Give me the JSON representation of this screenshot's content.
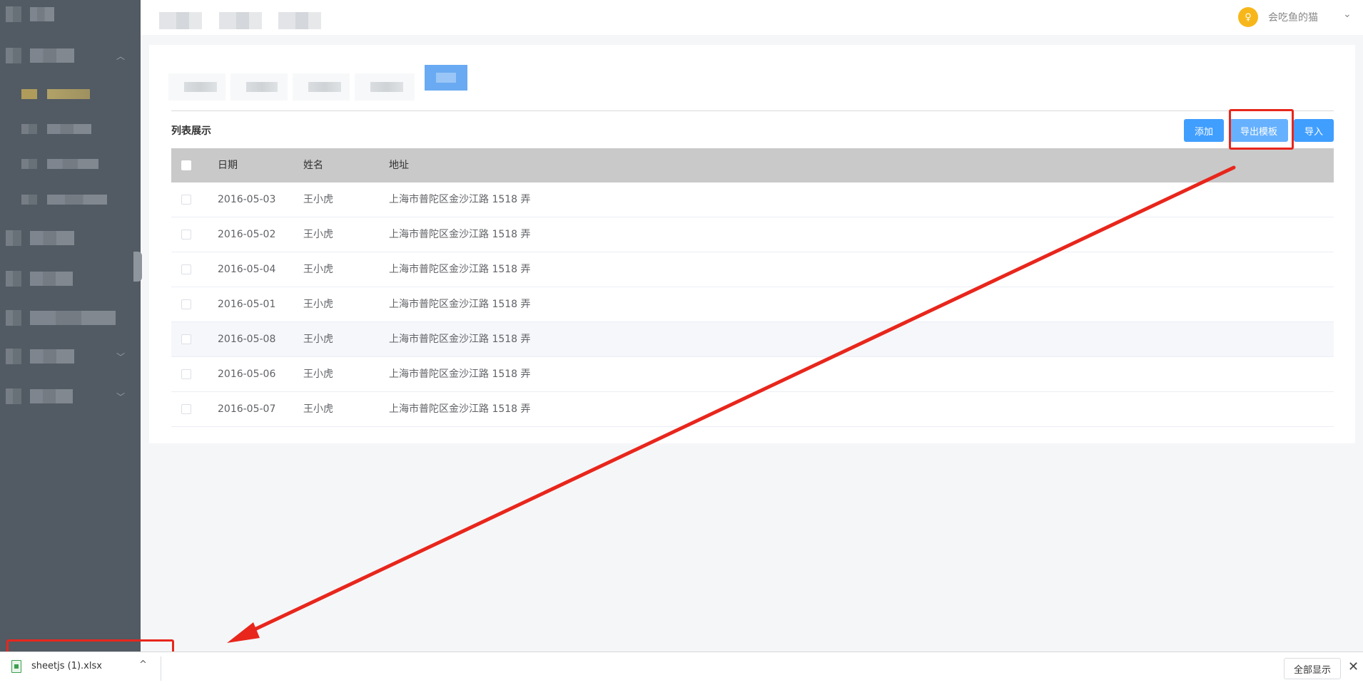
{
  "header": {
    "username": "会吃鱼的猫",
    "avatar_glyph": "♀",
    "chevron": "⌄"
  },
  "main": {
    "section_title": "列表展示",
    "buttons": {
      "add": "添加",
      "export_template": "导出模板",
      "import": "导入"
    },
    "table": {
      "columns": [
        "日期",
        "姓名",
        "地址"
      ],
      "rows": [
        {
          "date": "2016-05-03",
          "name": "王小虎",
          "address": "上海市普陀区金沙江路 1518 弄"
        },
        {
          "date": "2016-05-02",
          "name": "王小虎",
          "address": "上海市普陀区金沙江路 1518 弄"
        },
        {
          "date": "2016-05-04",
          "name": "王小虎",
          "address": "上海市普陀区金沙江路 1518 弄"
        },
        {
          "date": "2016-05-01",
          "name": "王小虎",
          "address": "上海市普陀区金沙江路 1518 弄"
        },
        {
          "date": "2016-05-08",
          "name": "王小虎",
          "address": "上海市普陀区金沙江路 1518 弄"
        },
        {
          "date": "2016-05-06",
          "name": "王小虎",
          "address": "上海市普陀区金沙江路 1518 弄"
        },
        {
          "date": "2016-05-07",
          "name": "王小虎",
          "address": "上海市普陀区金沙江路 1518 弄"
        }
      ]
    }
  },
  "download_bar": {
    "file_name": "sheetjs (1).xlsx",
    "chevron": "^",
    "show_all": "全部显示",
    "close": "✕"
  },
  "colors": {
    "primary": "#409eff",
    "primary_light": "#66b1ff",
    "annotation_red": "#e8261c",
    "sidebar_bg": "#525a63",
    "avatar": "#f7b71a"
  },
  "icons": {
    "avatar": "user-icon",
    "file": "excel-file-icon",
    "close": "close-icon"
  }
}
